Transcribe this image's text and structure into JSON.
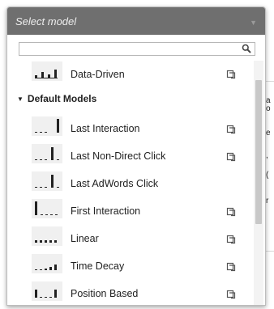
{
  "dropdown": {
    "header": "Select model",
    "search": {
      "value": "",
      "placeholder": ""
    }
  },
  "items_top": [
    {
      "label": "Data-Driven",
      "icon": "data-driven-thumbnail",
      "copy": true
    }
  ],
  "group": {
    "label": "Default Models",
    "expanded": true
  },
  "items": [
    {
      "label": "Last Interaction",
      "icon": "last-interaction-thumbnail",
      "copy": true
    },
    {
      "label": "Last Non-Direct Click",
      "icon": "last-non-direct-click-thumbnail",
      "copy": true
    },
    {
      "label": "Last AdWords Click",
      "icon": "last-adwords-click-thumbnail",
      "copy": false
    },
    {
      "label": "First Interaction",
      "icon": "first-interaction-thumbnail",
      "copy": true
    },
    {
      "label": "Linear",
      "icon": "linear-thumbnail",
      "copy": true
    },
    {
      "label": "Time Decay",
      "icon": "time-decay-thumbnail",
      "copy": true
    },
    {
      "label": "Position Based",
      "icon": "position-based-thumbnail",
      "copy": true
    }
  ],
  "colors": {
    "header_bg": "#6f6f6f",
    "thumb_bar": "#222222"
  }
}
